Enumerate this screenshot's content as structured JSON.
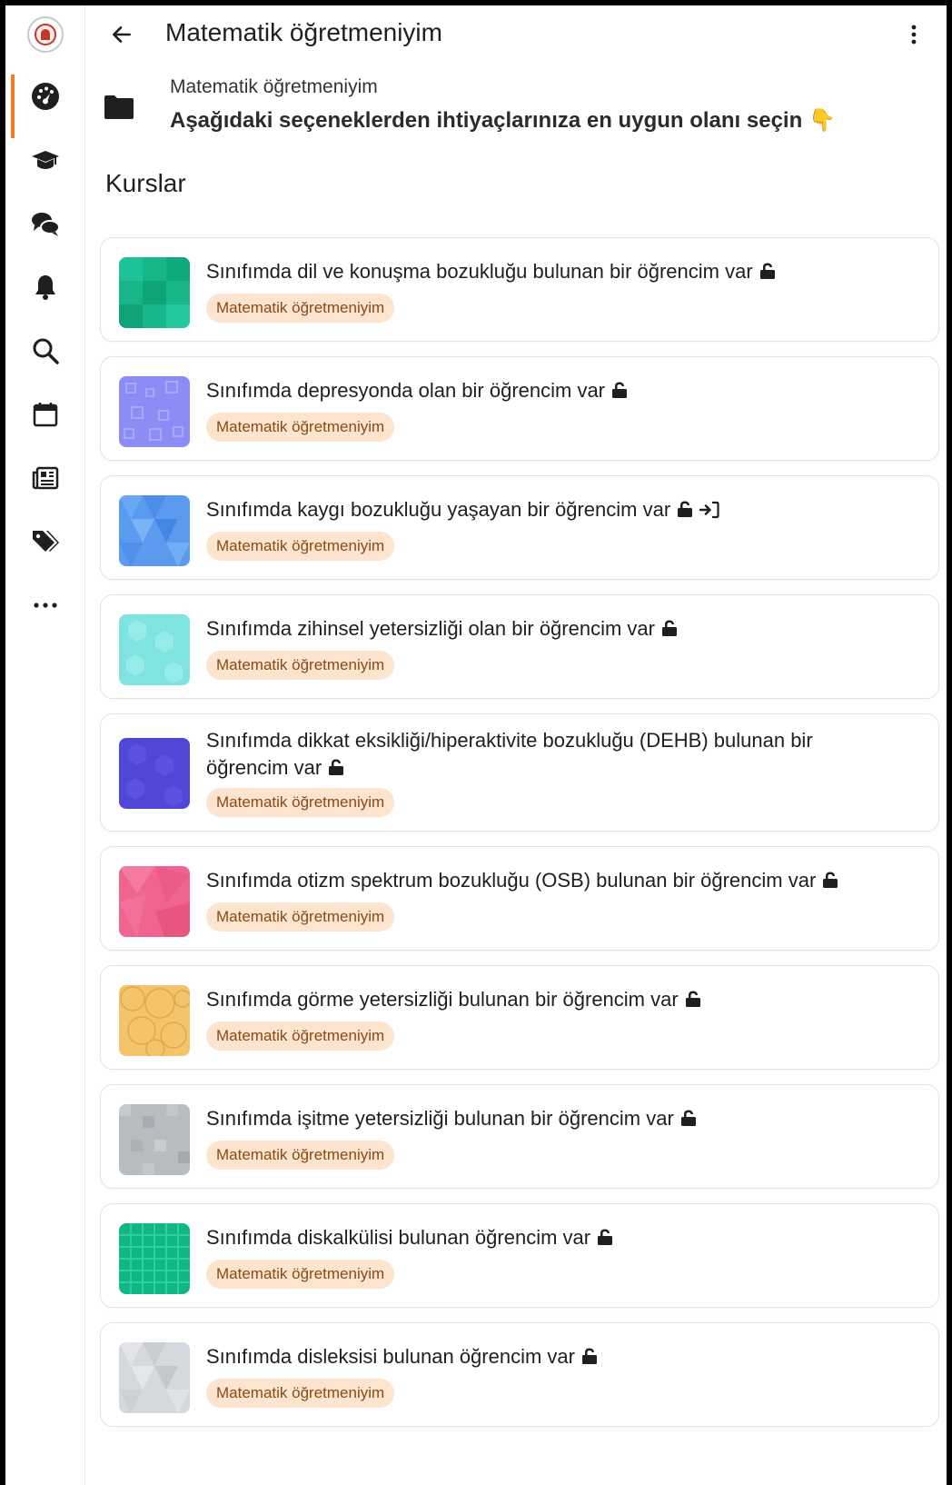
{
  "header": {
    "title": "Matematik öğretmeniyim"
  },
  "category": {
    "breadcrumb": "Matematik öğretmeniyim",
    "description": "Aşağıdaki seçeneklerden ihtiyaçlarınıza en uygun olanı seçin",
    "description_emoji": "👇"
  },
  "section": {
    "title": "Kurslar"
  },
  "sidebar": {
    "items": [
      {
        "icon": "dashboard-icon"
      },
      {
        "icon": "graduation-cap-icon"
      },
      {
        "icon": "chat-icon"
      },
      {
        "icon": "bell-icon"
      },
      {
        "icon": "search-icon"
      },
      {
        "icon": "calendar-icon"
      },
      {
        "icon": "news-icon"
      },
      {
        "icon": "tags-icon"
      },
      {
        "icon": "more-icon"
      }
    ]
  },
  "courses": [
    {
      "title": "Sınıfımda dil ve konuşma bozukluğu bulunan bir öğrencim var",
      "category": "Matematik öğretmeniyim"
    },
    {
      "title": "Sınıfımda depresyonda olan bir öğrencim var",
      "category": "Matematik öğretmeniyim"
    },
    {
      "title": "Sınıfımda kaygı bozukluğu yaşayan bir öğrencim var",
      "category": "Matematik öğretmeniyim"
    },
    {
      "title": "Sınıfımda zihinsel yetersizliği olan bir öğrencim var",
      "category": "Matematik öğretmeniyim"
    },
    {
      "title": "Sınıfımda dikkat eksikliği/hiperaktivite bozukluğu (DEHB) bulunan bir öğrencim var",
      "category": "Matematik öğretmeniyim"
    },
    {
      "title": "Sınıfımda otizm spektrum bozukluğu (OSB) bulunan bir öğrencim var",
      "category": "Matematik öğretmeniyim"
    },
    {
      "title": "Sınıfımda görme yetersizliği bulunan bir öğrencim var",
      "category": "Matematik öğretmeniyim"
    },
    {
      "title": "Sınıfımda işitme yetersizliği bulunan bir öğrencim var",
      "category": "Matematik öğretmeniyim"
    },
    {
      "title": "Sınıfımda diskalkülisi bulunan öğrencim var",
      "category": "Matematik öğretmeniyim"
    },
    {
      "title": "Sınıfımda disleksisi bulunan öğrencim var",
      "category": "Matematik öğretmeniyim"
    }
  ],
  "colors": {
    "accent": "#f47b20",
    "badge_bg": "#fde4cf",
    "badge_text": "#8a4a14",
    "thumbs": [
      "#16b58a",
      "#8b8cf5",
      "#5a9bf0",
      "#7fe3df",
      "#5046d8",
      "#f06490",
      "#f3c46b",
      "#b8bcc1",
      "#12b585",
      "#d5d8dc"
    ]
  }
}
